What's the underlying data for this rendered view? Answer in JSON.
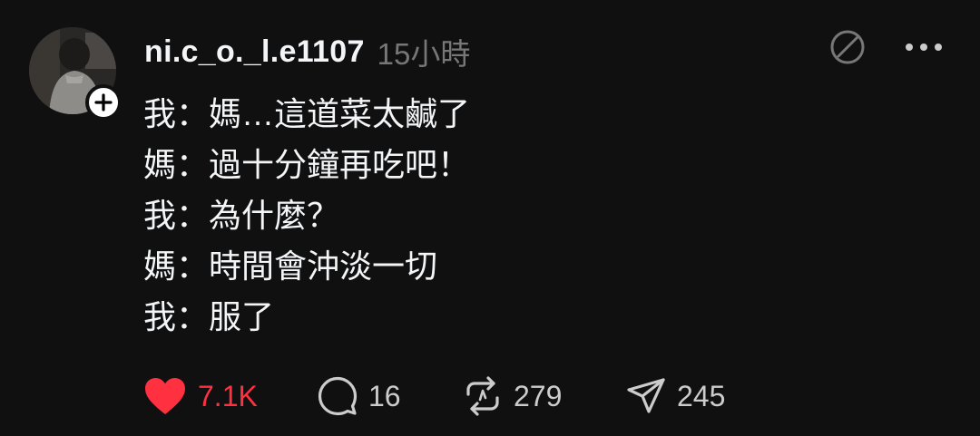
{
  "post": {
    "username": "ni.c_o._l.e1107",
    "timestamp": "15小時",
    "lines": [
      "我：媽…這道菜太鹹了",
      "媽：過十分鐘再吃吧！",
      "我：為什麼？",
      "媽：時間會沖淡一切",
      "我：服了"
    ]
  },
  "actions": {
    "like_count": "7.1K",
    "reply_count": "16",
    "repost_count": "279",
    "share_count": "245"
  },
  "icons": {
    "follow": "plus-icon",
    "unfollow_feed": "slash-circle-icon",
    "more": "more-dots-icon",
    "like": "heart-icon",
    "reply": "speech-bubble-icon",
    "repost": "repost-arrows-icon",
    "share": "paper-plane-icon"
  },
  "colors": {
    "background": "#101010",
    "text": "#f3f5f7",
    "muted": "#777777",
    "like_red": "#ff3040"
  }
}
